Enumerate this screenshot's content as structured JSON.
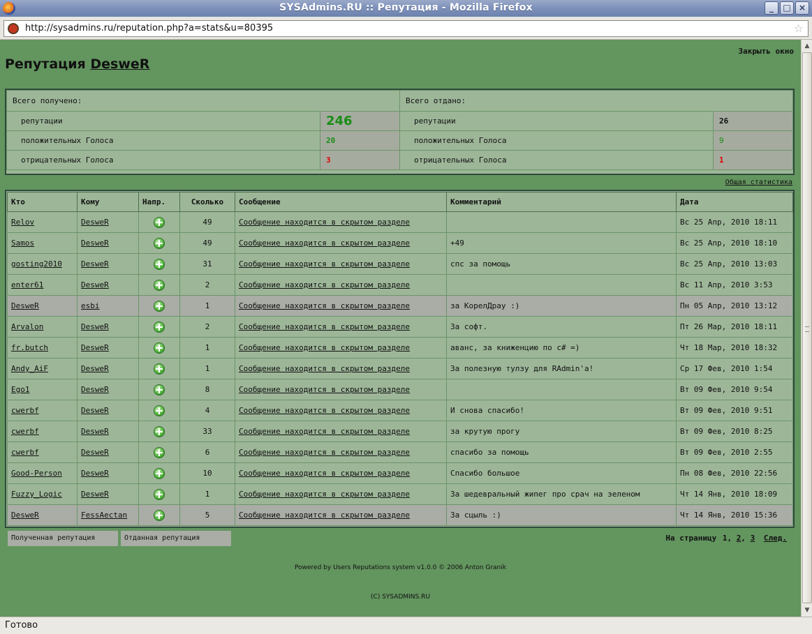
{
  "window": {
    "title": "SYSAdmins.RU :: Репутация - Mozilla Firefox",
    "url": "http://sysadmins.ru/reputation.php?a=stats&u=80395",
    "status": "Готово"
  },
  "page": {
    "close_label": "Закрыть окно",
    "title_prefix": "Репутация",
    "username": "DesweR",
    "total_stats_label": "Общая статистика"
  },
  "summary": {
    "received_header": "Всего получено:",
    "given_header": "Всего отдано:",
    "received": {
      "reputation_label": "репутации",
      "reputation": "246",
      "positive_label": "положительных Голоса",
      "positive": "20",
      "negative_label": "отрицательных Голоса",
      "negative": "3"
    },
    "given": {
      "reputation_label": "репутации",
      "reputation": "26",
      "positive_label": "положительных Голоса",
      "positive": "9",
      "negative_label": "отрицательных Голоса",
      "negative": "1"
    }
  },
  "votes": {
    "columns": [
      "Кто",
      "Кому",
      "Напр.",
      "Сколько",
      "Сообщение",
      "Комментарий",
      "Дата"
    ],
    "rows": [
      {
        "who": "Relov",
        "to": "DesweR",
        "amount": "49",
        "message": "Сообщение находится в скрытом разделе",
        "comment": "",
        "date": "Вс 25 Апр, 2010 18:11"
      },
      {
        "who": "Samos",
        "to": "DesweR",
        "amount": "49",
        "message": "Сообщение находится в скрытом разделе",
        "comment": "+49",
        "date": "Вс 25 Апр, 2010 18:10"
      },
      {
        "who": "gosting2010",
        "to": "DesweR",
        "amount": "31",
        "message": "Сообщение находится в скрытом разделе",
        "comment": "спс за помощь",
        "date": "Вс 25 Апр, 2010 13:03"
      },
      {
        "who": "enter61",
        "to": "DesweR",
        "amount": "2",
        "message": "Сообщение находится в скрытом разделе",
        "comment": "",
        "date": "Вс 11 Апр, 2010 3:53"
      },
      {
        "who": "DesweR",
        "to": "esbi",
        "amount": "1",
        "message": "Сообщение находится в скрытом разделе",
        "comment": "за КорелДрау :)",
        "date": "Пн 05 Апр, 2010 13:12"
      },
      {
        "who": "Arvalon",
        "to": "DesweR",
        "amount": "2",
        "message": "Сообщение находится в скрытом разделе",
        "comment": "За софт.",
        "date": "Пт 26 Мар, 2010 18:11"
      },
      {
        "who": "fr.butch",
        "to": "DesweR",
        "amount": "1",
        "message": "Сообщение находится в скрытом разделе",
        "comment": "аванс, за книженцию по c# =)",
        "date": "Чт 18 Мар, 2010 18:32"
      },
      {
        "who": "Andy_AiF",
        "to": "DesweR",
        "amount": "1",
        "message": "Сообщение находится в скрытом разделе",
        "comment": "За полезную тулзу для RAdmin'a!",
        "date": "Ср 17 Фев, 2010 1:54"
      },
      {
        "who": "Ego1",
        "to": "DesweR",
        "amount": "8",
        "message": "Сообщение находится в скрытом разделе",
        "comment": "",
        "date": "Вт 09 Фев, 2010 9:54"
      },
      {
        "who": "cwerbf",
        "to": "DesweR",
        "amount": "4",
        "message": "Сообщение находится в скрытом разделе",
        "comment": "И снова спасибо!",
        "date": "Вт 09 Фев, 2010 9:51"
      },
      {
        "who": "cwerbf",
        "to": "DesweR",
        "amount": "33",
        "message": "Сообщение находится в скрытом разделе",
        "comment": "за крутую прогу",
        "date": "Вт 09 Фев, 2010 8:25"
      },
      {
        "who": "cwerbf",
        "to": "DesweR",
        "amount": "6",
        "message": "Сообщение находится в скрытом разделе",
        "comment": "спасибо за помощь",
        "date": "Вт 09 Фев, 2010 2:55"
      },
      {
        "who": "Good-Person",
        "to": "DesweR",
        "amount": "10",
        "message": "Сообщение находится в скрытом разделе",
        "comment": "Спасибо большое",
        "date": "Пн 08 Фев, 2010 22:56"
      },
      {
        "who": "Fuzzy_Logic",
        "to": "DesweR",
        "amount": "1",
        "message": "Сообщение находится в скрытом разделе",
        "comment": "За шедевральный жипег про срач на зеленом",
        "date": "Чт 14 Янв, 2010 18:09"
      },
      {
        "who": "DesweR",
        "to": "FessAectan",
        "amount": "5",
        "message": "Сообщение находится в скрытом разделе",
        "comment": "За сцыль :)",
        "date": "Чт 14 Янв, 2010 15:36"
      }
    ]
  },
  "footer": {
    "tab_received": "Полученная репутация",
    "tab_given": "Отданная репутация",
    "pager_label": "На страницу",
    "pages": [
      "1",
      "2",
      "3"
    ],
    "next_label": "След.",
    "powered": "Powered by Users Reputations system v1.0.0 © 2006 Anton Granik",
    "copyright": "(C) SYSADMINS.RU"
  }
}
